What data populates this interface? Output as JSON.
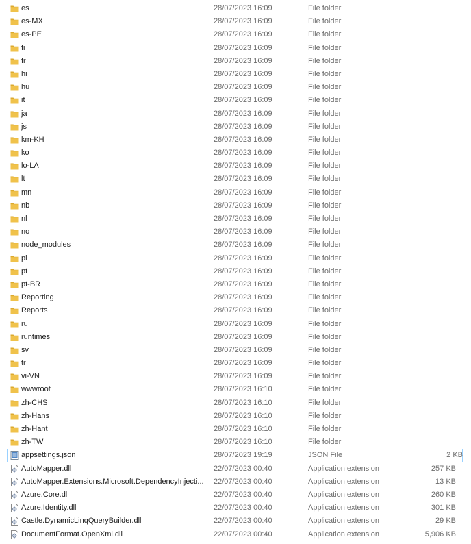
{
  "colors": {
    "folder": "#f0c24b",
    "folder_dark": "#dcaa2e",
    "selection_border": "#99d1ff"
  },
  "rows": [
    {
      "name": "es",
      "date": "28/07/2023 16:09",
      "type": "File folder",
      "size": "",
      "icon": "folder-icon"
    },
    {
      "name": "es-MX",
      "date": "28/07/2023 16:09",
      "type": "File folder",
      "size": "",
      "icon": "folder-icon"
    },
    {
      "name": "es-PE",
      "date": "28/07/2023 16:09",
      "type": "File folder",
      "size": "",
      "icon": "folder-icon"
    },
    {
      "name": "fi",
      "date": "28/07/2023 16:09",
      "type": "File folder",
      "size": "",
      "icon": "folder-icon"
    },
    {
      "name": "fr",
      "date": "28/07/2023 16:09",
      "type": "File folder",
      "size": "",
      "icon": "folder-icon"
    },
    {
      "name": "hi",
      "date": "28/07/2023 16:09",
      "type": "File folder",
      "size": "",
      "icon": "folder-icon"
    },
    {
      "name": "hu",
      "date": "28/07/2023 16:09",
      "type": "File folder",
      "size": "",
      "icon": "folder-icon"
    },
    {
      "name": "it",
      "date": "28/07/2023 16:09",
      "type": "File folder",
      "size": "",
      "icon": "folder-icon"
    },
    {
      "name": "ja",
      "date": "28/07/2023 16:09",
      "type": "File folder",
      "size": "",
      "icon": "folder-icon"
    },
    {
      "name": "js",
      "date": "28/07/2023 16:09",
      "type": "File folder",
      "size": "",
      "icon": "folder-icon"
    },
    {
      "name": "km-KH",
      "date": "28/07/2023 16:09",
      "type": "File folder",
      "size": "",
      "icon": "folder-icon"
    },
    {
      "name": "ko",
      "date": "28/07/2023 16:09",
      "type": "File folder",
      "size": "",
      "icon": "folder-icon"
    },
    {
      "name": "lo-LA",
      "date": "28/07/2023 16:09",
      "type": "File folder",
      "size": "",
      "icon": "folder-icon"
    },
    {
      "name": "lt",
      "date": "28/07/2023 16:09",
      "type": "File folder",
      "size": "",
      "icon": "folder-icon"
    },
    {
      "name": "mn",
      "date": "28/07/2023 16:09",
      "type": "File folder",
      "size": "",
      "icon": "folder-icon"
    },
    {
      "name": "nb",
      "date": "28/07/2023 16:09",
      "type": "File folder",
      "size": "",
      "icon": "folder-icon"
    },
    {
      "name": "nl",
      "date": "28/07/2023 16:09",
      "type": "File folder",
      "size": "",
      "icon": "folder-icon"
    },
    {
      "name": "no",
      "date": "28/07/2023 16:09",
      "type": "File folder",
      "size": "",
      "icon": "folder-icon"
    },
    {
      "name": "node_modules",
      "date": "28/07/2023 16:09",
      "type": "File folder",
      "size": "",
      "icon": "folder-icon"
    },
    {
      "name": "pl",
      "date": "28/07/2023 16:09",
      "type": "File folder",
      "size": "",
      "icon": "folder-icon"
    },
    {
      "name": "pt",
      "date": "28/07/2023 16:09",
      "type": "File folder",
      "size": "",
      "icon": "folder-icon"
    },
    {
      "name": "pt-BR",
      "date": "28/07/2023 16:09",
      "type": "File folder",
      "size": "",
      "icon": "folder-icon"
    },
    {
      "name": "Reporting",
      "date": "28/07/2023 16:09",
      "type": "File folder",
      "size": "",
      "icon": "folder-icon"
    },
    {
      "name": "Reports",
      "date": "28/07/2023 16:09",
      "type": "File folder",
      "size": "",
      "icon": "folder-icon"
    },
    {
      "name": "ru",
      "date": "28/07/2023 16:09",
      "type": "File folder",
      "size": "",
      "icon": "folder-icon"
    },
    {
      "name": "runtimes",
      "date": "28/07/2023 16:09",
      "type": "File folder",
      "size": "",
      "icon": "folder-icon"
    },
    {
      "name": "sv",
      "date": "28/07/2023 16:09",
      "type": "File folder",
      "size": "",
      "icon": "folder-icon"
    },
    {
      "name": "tr",
      "date": "28/07/2023 16:09",
      "type": "File folder",
      "size": "",
      "icon": "folder-icon"
    },
    {
      "name": "vi-VN",
      "date": "28/07/2023 16:09",
      "type": "File folder",
      "size": "",
      "icon": "folder-icon"
    },
    {
      "name": "wwwroot",
      "date": "28/07/2023 16:10",
      "type": "File folder",
      "size": "",
      "icon": "folder-icon"
    },
    {
      "name": "zh-CHS",
      "date": "28/07/2023 16:10",
      "type": "File folder",
      "size": "",
      "icon": "folder-icon"
    },
    {
      "name": "zh-Hans",
      "date": "28/07/2023 16:10",
      "type": "File folder",
      "size": "",
      "icon": "folder-icon"
    },
    {
      "name": "zh-Hant",
      "date": "28/07/2023 16:10",
      "type": "File folder",
      "size": "",
      "icon": "folder-icon"
    },
    {
      "name": "zh-TW",
      "date": "28/07/2023 16:10",
      "type": "File folder",
      "size": "",
      "icon": "folder-icon"
    },
    {
      "name": "appsettings.json",
      "date": "28/07/2023 19:19",
      "type": "JSON File",
      "size": "2 KB",
      "icon": "json-file-icon",
      "selected": true
    },
    {
      "name": "AutoMapper.dll",
      "date": "22/07/2023 00:40",
      "type": "Application extension",
      "size": "257 KB",
      "icon": "dll-file-icon"
    },
    {
      "name": "AutoMapper.Extensions.Microsoft.DependencyInjecti...",
      "date": "22/07/2023 00:40",
      "type": "Application extension",
      "size": "13 KB",
      "icon": "dll-file-icon"
    },
    {
      "name": "Azure.Core.dll",
      "date": "22/07/2023 00:40",
      "type": "Application extension",
      "size": "260 KB",
      "icon": "dll-file-icon"
    },
    {
      "name": "Azure.Identity.dll",
      "date": "22/07/2023 00:40",
      "type": "Application extension",
      "size": "301 KB",
      "icon": "dll-file-icon"
    },
    {
      "name": "Castle.DynamicLinqQueryBuilder.dll",
      "date": "22/07/2023 00:40",
      "type": "Application extension",
      "size": "29 KB",
      "icon": "dll-file-icon"
    },
    {
      "name": "DocumentFormat.OpenXml.dll",
      "date": "22/07/2023 00:40",
      "type": "Application extension",
      "size": "5,906 KB",
      "icon": "dll-file-icon"
    }
  ]
}
